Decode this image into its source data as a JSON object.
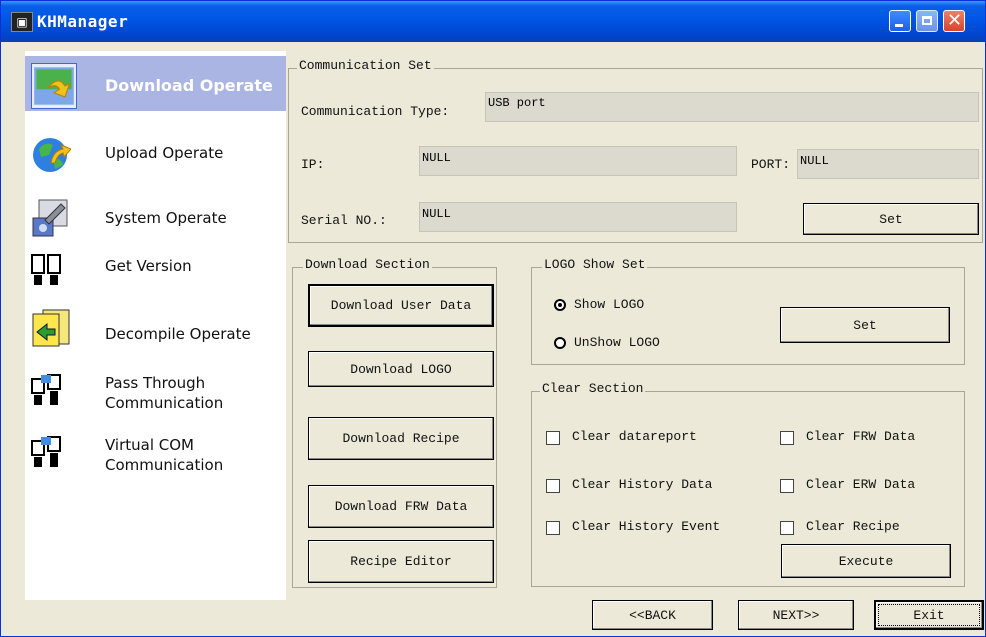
{
  "window": {
    "title": "KHManager",
    "app_icon": "app-icon"
  },
  "sidebar": {
    "items": [
      {
        "label": "Download Operate",
        "icon": "download-icon",
        "selected": true
      },
      {
        "label": "Upload Operate",
        "icon": "upload-icon"
      },
      {
        "label": "System Operate",
        "icon": "system-icon"
      },
      {
        "label": "Get Version",
        "icon": "version-icon"
      },
      {
        "label": "Decompile Operate",
        "icon": "decompile-icon"
      },
      {
        "label": "Pass Through",
        "label2": "Communication",
        "icon": "pass-through-icon"
      },
      {
        "label": "Virtual COM",
        "label2": "Communication",
        "icon": "virtual-com-icon"
      }
    ]
  },
  "communication": {
    "title": "Communication Set",
    "type_label": "Communication Type:",
    "type_value": "USB port",
    "ip_label": "IP:",
    "ip_value": "NULL",
    "port_label": "PORT:",
    "port_value": "NULL",
    "serial_label": "Serial NO.:",
    "serial_value": "NULL",
    "set_label": "Set"
  },
  "download": {
    "title": "Download Section",
    "buttons": [
      "Download User Data",
      "Download LOGO",
      "Download Recipe",
      "Download FRW Data",
      "Recipe Editor"
    ]
  },
  "logo": {
    "title": "LOGO Show Set",
    "show_label": "Show LOGO",
    "unshow_label": "UnShow LOGO",
    "selected": "Show LOGO",
    "set_label": "Set"
  },
  "clear": {
    "title": "Clear Section",
    "options": [
      "Clear datareport",
      "Clear FRW Data",
      "Clear History Data",
      "Clear ERW Data",
      "Clear History Event",
      "Clear Recipe"
    ],
    "execute_label": "Execute"
  },
  "footer": {
    "back_label": "<<BACK",
    "next_label": "NEXT>>",
    "exit_label": "Exit"
  },
  "colors": {
    "titlebar": "#0055e5",
    "dialog_bg": "#ece9d8",
    "sidebar_selected": "#aab5e4"
  }
}
